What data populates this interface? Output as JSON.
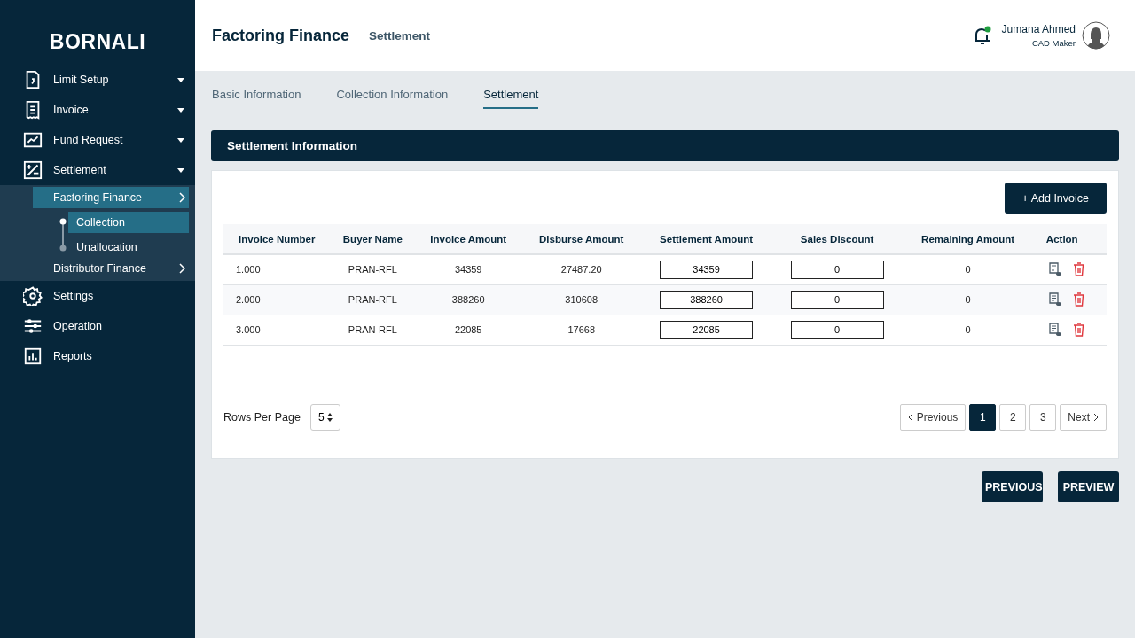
{
  "sidebar": {
    "brand": "BORNALI",
    "items": [
      {
        "label": "Limit Setup"
      },
      {
        "label": "Invoice"
      },
      {
        "label": "Fund Request"
      },
      {
        "label": "Settlement",
        "children": [
          {
            "label": "Factoring Finance",
            "selected": true,
            "children": [
              {
                "label": "Collection",
                "selected": true
              },
              {
                "label": "Unallocation",
                "selected": false
              }
            ]
          },
          {
            "label": "Distributor Finance",
            "selected": false
          }
        ]
      },
      {
        "label": "Settings"
      },
      {
        "label": "Operation"
      },
      {
        "label": "Reports"
      }
    ]
  },
  "header": {
    "title": "Factoring Finance",
    "subtitle": "Settlement",
    "user": {
      "name": "Jumana Ahmed",
      "role": "CAD Maker",
      "notification": true
    }
  },
  "tabs": [
    {
      "label": "Basic Information",
      "selected": false
    },
    {
      "label": "Collection Information",
      "selected": false
    },
    {
      "label": "Settlement",
      "selected": true
    }
  ],
  "section_title": "Settlement Information",
  "add_button": "+ Add Invoice",
  "table": {
    "columns": [
      "Invoice Number",
      "Buyer Name",
      "Invoice Amount",
      "Disburse Amount",
      "Settlement Amount",
      "Sales Discount",
      "Remaining Amount",
      "Action"
    ],
    "rows": [
      {
        "invoice_number": "1.000",
        "buyer_name": "PRAN-RFL",
        "invoice_amount": "34359",
        "disburse_amount": "27487.20",
        "settlement_amount": "34359",
        "sales_discount": "0",
        "remaining_amount": "0"
      },
      {
        "invoice_number": "2.000",
        "buyer_name": "PRAN-RFL",
        "invoice_amount": "388260",
        "disburse_amount": "310608",
        "settlement_amount": "388260",
        "sales_discount": "0",
        "remaining_amount": "0"
      },
      {
        "invoice_number": "3.000",
        "buyer_name": "PRAN-RFL",
        "invoice_amount": "22085",
        "disburse_amount": "17668",
        "settlement_amount": "22085",
        "sales_discount": "0",
        "remaining_amount": "0"
      }
    ]
  },
  "rows_per_page": {
    "label": "Rows Per Page",
    "value": "5"
  },
  "pagination": {
    "previous": "Previous",
    "pages": [
      {
        "label": "1",
        "selected": true
      },
      {
        "label": "2",
        "selected": false
      },
      {
        "label": "3",
        "selected": false
      }
    ],
    "next": "Next"
  },
  "footer_buttons": [
    "PREVIOUS",
    "PREVIEW"
  ]
}
